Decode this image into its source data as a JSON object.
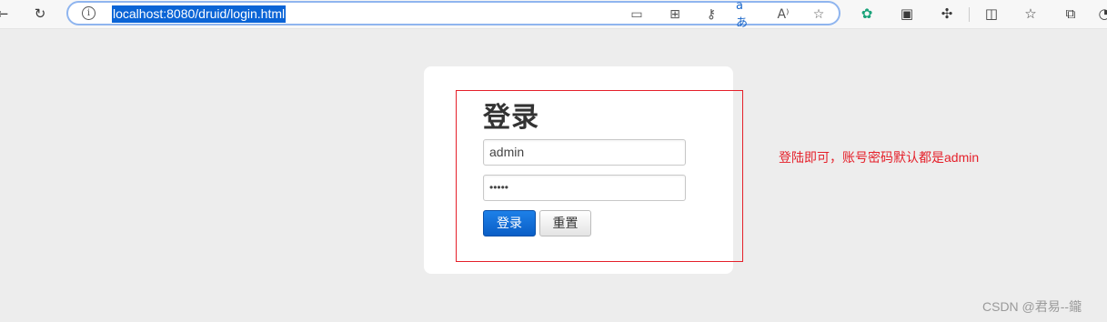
{
  "browser": {
    "url": "localhost:8080/druid/login.html",
    "icons": {
      "back": "back-arrow-icon",
      "refresh": "refresh-icon",
      "info": "site-info-icon",
      "read_aloud": "read-aloud-icon",
      "favorite": "favorite-star-icon",
      "extensions": "extensions-icon",
      "split_screen": "split-screen-icon",
      "favorites_bar": "favorites-icon",
      "collections": "collections-icon",
      "profile": "profile-icon"
    },
    "translate_label": "aあ",
    "read_aloud_label": "A⁾",
    "accent_color": "#8fb5ef",
    "selection_color": "#0a64d6"
  },
  "login": {
    "title": "登录",
    "username_value": "admin",
    "password_mask": "•••••",
    "login_button": "登录",
    "reset_button": "重置"
  },
  "annotation": {
    "note": "登陆即可，账号密码默认都是admin",
    "color": "#e5202a"
  },
  "watermark": "CSDN @君易--鑨"
}
